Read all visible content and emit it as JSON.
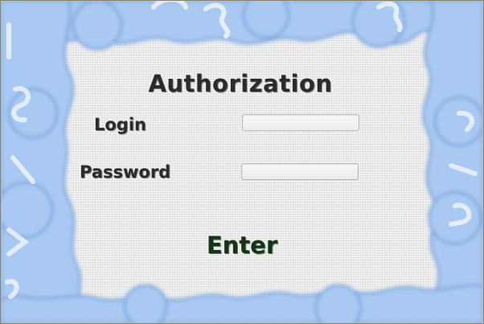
{
  "window": {
    "title": "Authorization"
  },
  "form": {
    "login_label": "Login",
    "login_value": "",
    "password_label": "Password",
    "password_value": "",
    "enter_label": "Enter"
  },
  "colors": {
    "background": "#f2f3f2",
    "puzzle_fill": "#a9c9f2",
    "puzzle_edge": "#7fa6e0",
    "text": "#2b2b2b",
    "enter_text": "#16331a"
  }
}
